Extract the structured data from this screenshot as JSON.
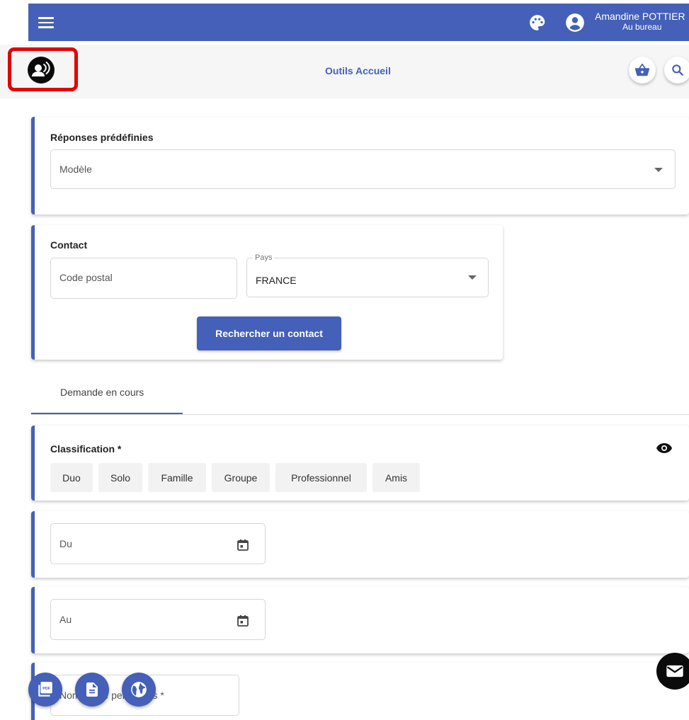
{
  "header": {
    "user_name": "Amandine POTTIER",
    "user_status": "Au bureau",
    "brand_color": "#4460b8",
    "icons": [
      "menu-icon",
      "palette-icon",
      "account-circle-icon"
    ]
  },
  "toolbar": {
    "title": "Outils Accueil",
    "icons": [
      "voice-call-icon",
      "basket-icon",
      "search-icon"
    ]
  },
  "predefined": {
    "title": "Réponses prédéfinies",
    "model_placeholder": "Modèle"
  },
  "contact": {
    "title": "Contact",
    "postal_placeholder": "Code postal",
    "country_label": "Pays",
    "country_value": "FRANCE",
    "search_button": "Rechercher un contact"
  },
  "tabs": [
    {
      "label": "Demande en cours",
      "active": true
    }
  ],
  "classification": {
    "title": "Classification *",
    "options": [
      "Duo",
      "Solo",
      "Famille",
      "Groupe",
      "Professionnel",
      "Amis"
    ]
  },
  "dates": {
    "from_label": "Du",
    "to_label": "Au"
  },
  "people": {
    "label_visible": "Nombre de personnes *"
  },
  "fabs": [
    "pdf-icon",
    "document-icon",
    "globe-icon",
    "mail-icon"
  ],
  "highlight_color": "#e50000"
}
